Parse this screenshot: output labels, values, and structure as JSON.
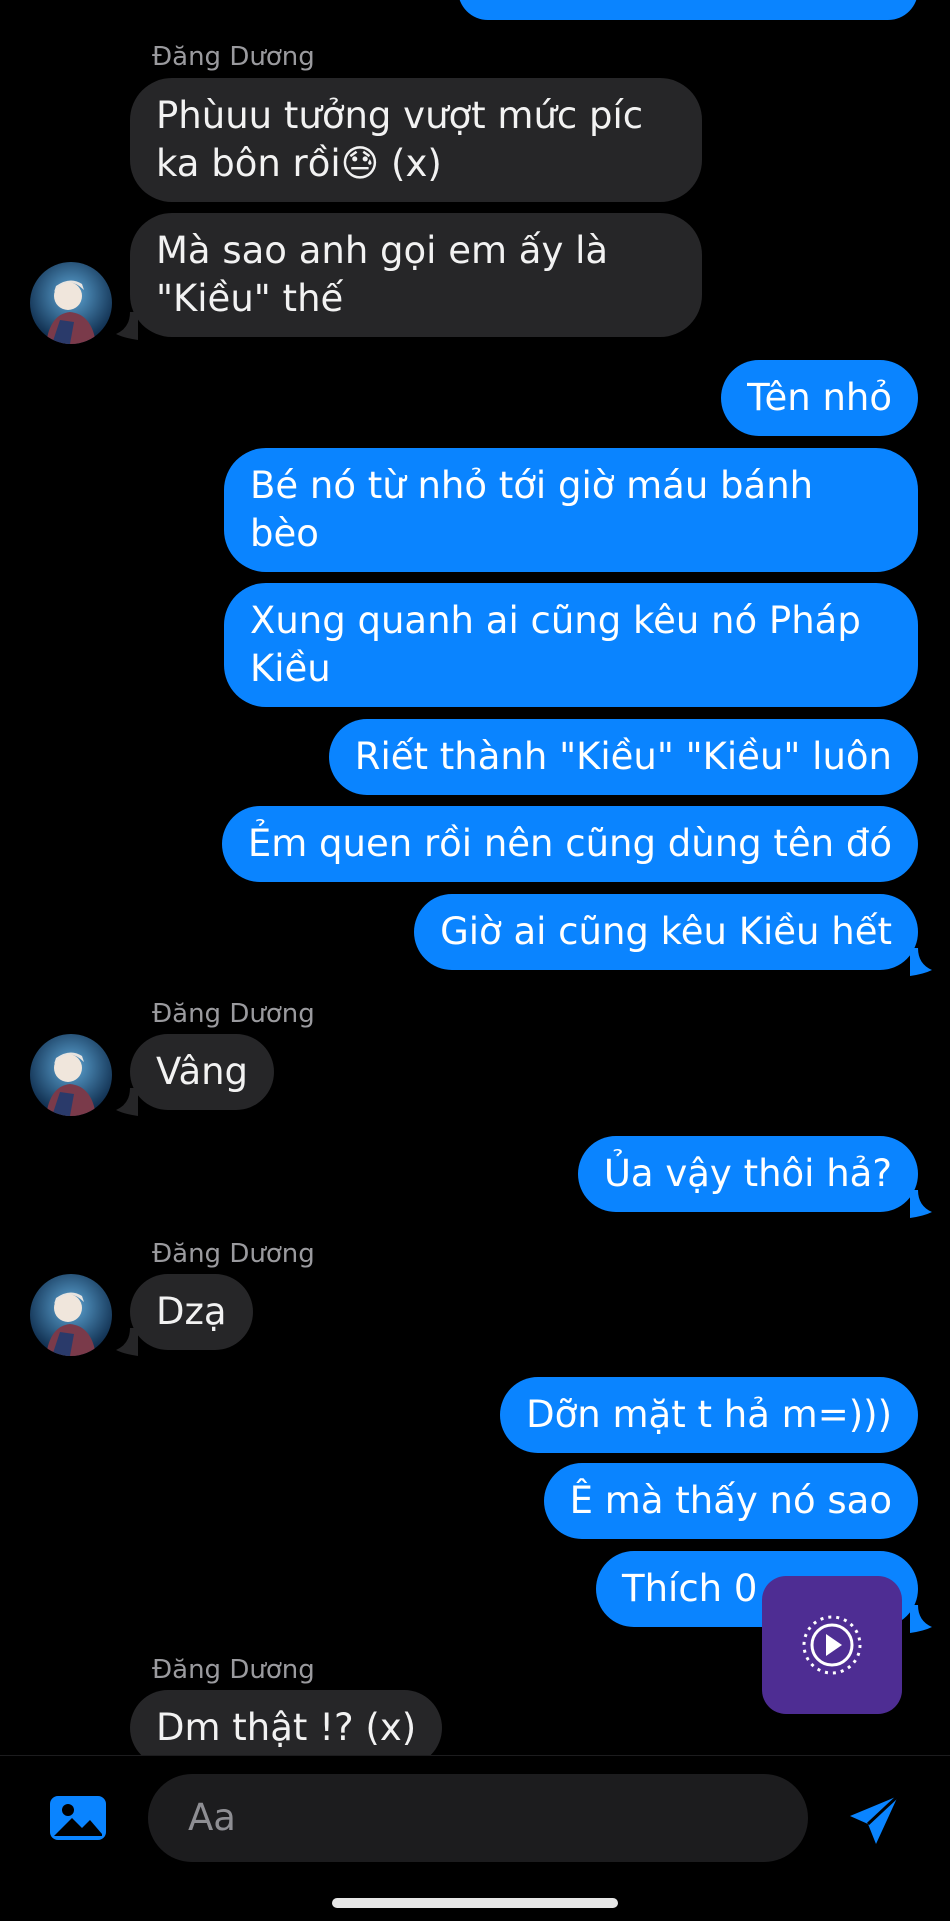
{
  "conversation": {
    "sender_name": "Đăng Dương",
    "messages": [
      {
        "from": "me",
        "text": "",
        "type": "partial"
      },
      {
        "from": "them",
        "lines": [
          "Phùuu tưởng vượt mức píc",
          "ka bôn rồi😓 (x)"
        ]
      },
      {
        "from": "them",
        "lines": [
          "Mà sao anh gọi em ấy là",
          "\"Kiều\" thế"
        ]
      },
      {
        "from": "me",
        "text": "Tên nhỏ"
      },
      {
        "from": "me",
        "lines": [
          "Bé nó từ nhỏ tới giờ máu bánh",
          "bèo"
        ]
      },
      {
        "from": "me",
        "lines": [
          "Xung quanh ai cũng kêu nó Pháp",
          "Kiều"
        ]
      },
      {
        "from": "me",
        "text": "Riết thành \"Kiều\" \"Kiều\" luôn"
      },
      {
        "from": "me",
        "text": "Ẻm quen rồi nên cũng dùng tên đó"
      },
      {
        "from": "me",
        "text": "Giờ ai cũng kêu Kiều hết"
      },
      {
        "from": "them",
        "text": "Vâng"
      },
      {
        "from": "me",
        "text": "Ủa vậy thôi hả?"
      },
      {
        "from": "them",
        "text": "Dzạ"
      },
      {
        "from": "me",
        "text": "Dỡn mặt t hả m=)))"
      },
      {
        "from": "me",
        "text": "Ê mà thấy nó sao"
      },
      {
        "from": "me",
        "text": "Thích 0"
      },
      {
        "from": "them",
        "text": "Dm thật !? (x)"
      }
    ]
  },
  "composer": {
    "placeholder": "Aa",
    "gallery_icon": "image-icon",
    "send_icon": "send-icon"
  },
  "overlay": {
    "floating_button_icon": "play-circle-icon"
  },
  "colors": {
    "background": "#000000",
    "incoming_bubble": "#262628",
    "outgoing_bubble": "#0a84ff",
    "floating_button": "#4e2d93",
    "accent": "#0a84ff"
  }
}
